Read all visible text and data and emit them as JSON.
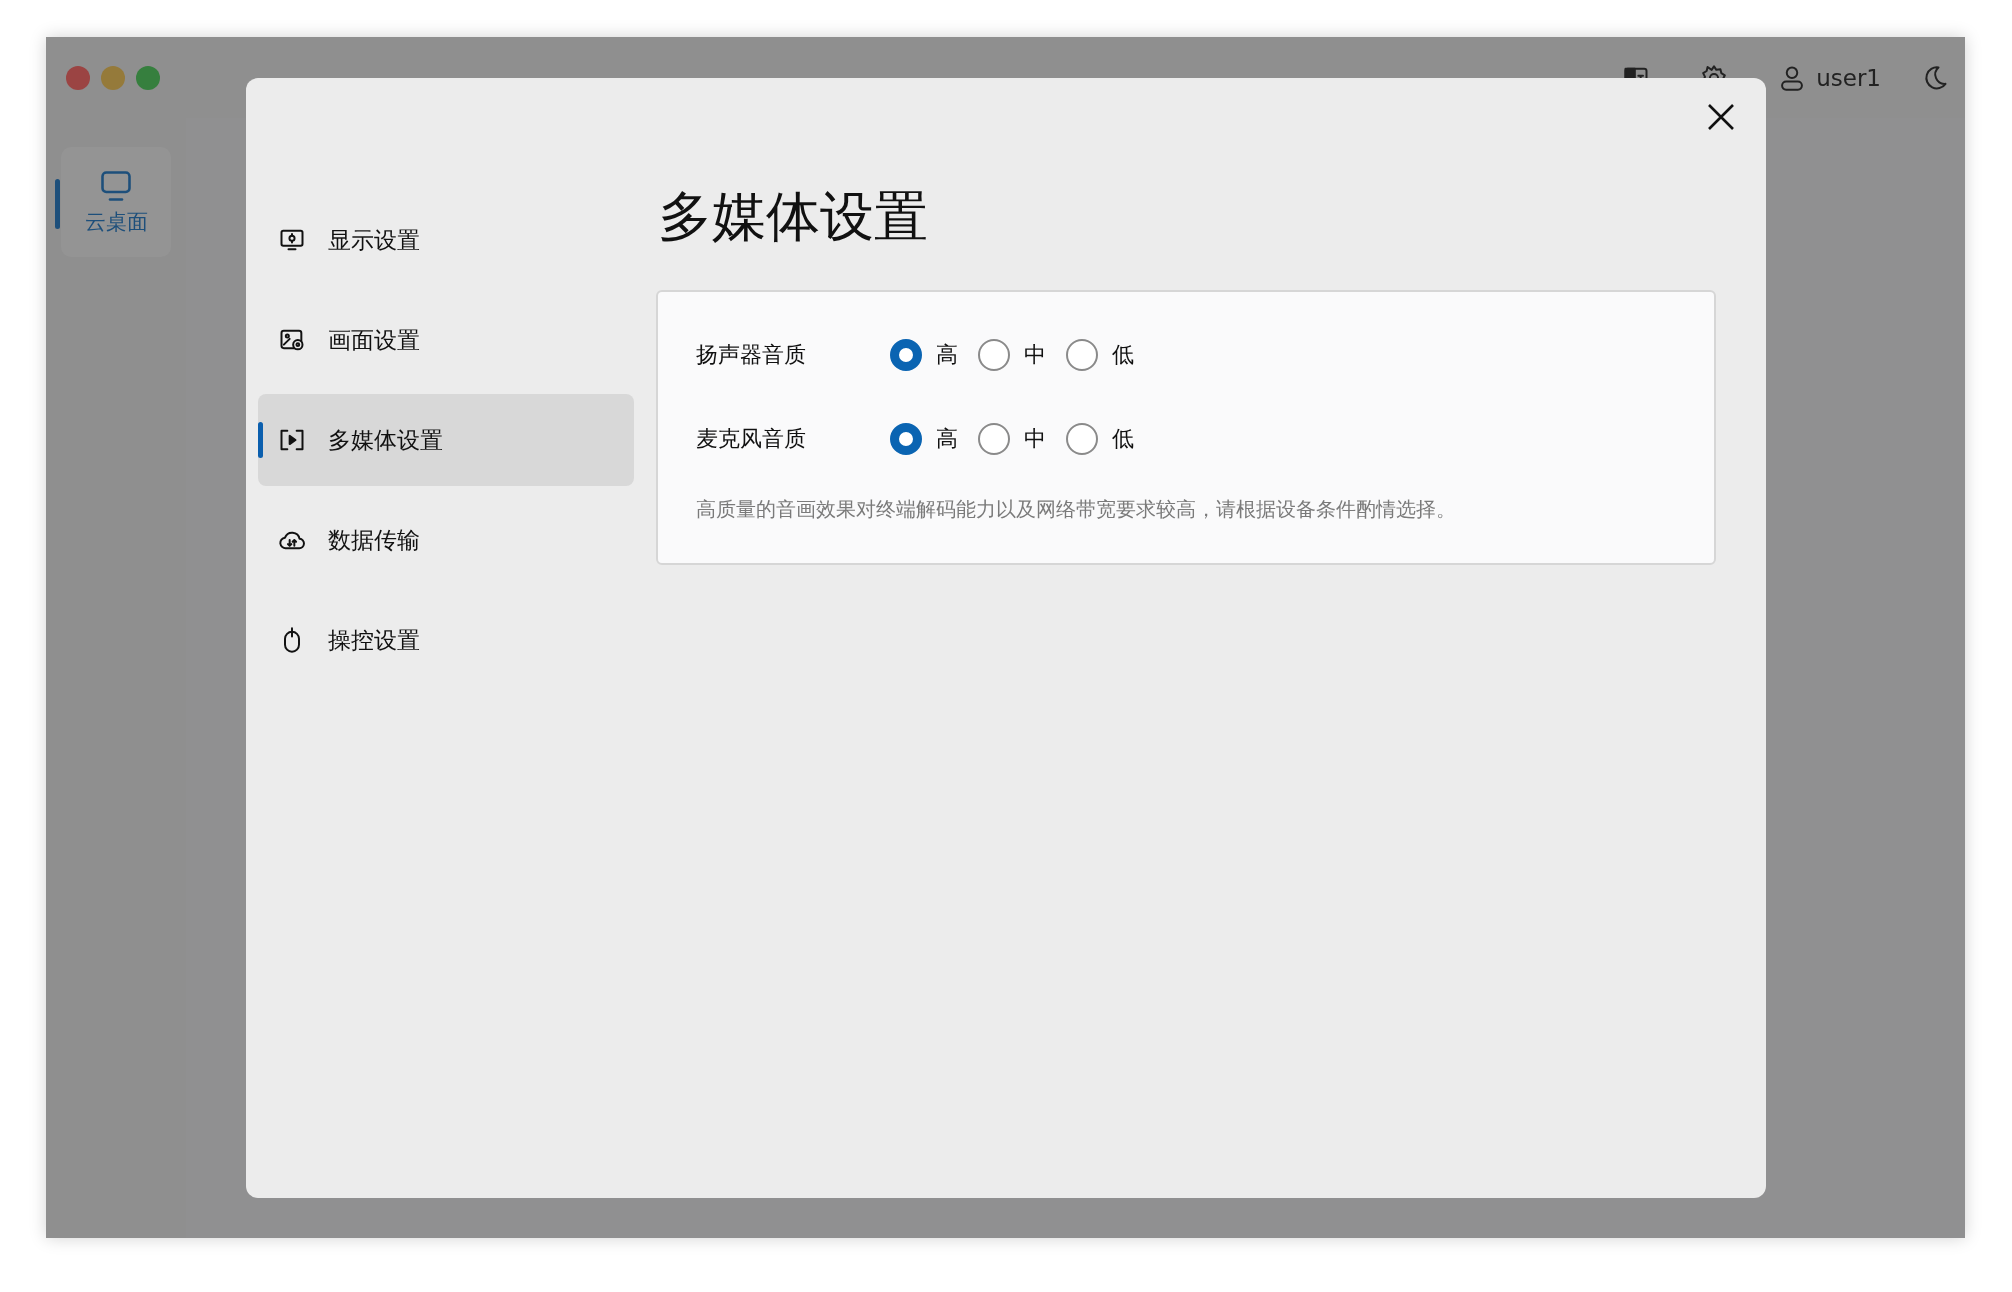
{
  "window": {
    "traffic_lights": [
      {
        "color": "#9b4443"
      },
      {
        "color": "#957a3a"
      },
      {
        "color": "#367f3e"
      }
    ]
  },
  "top_bar": {
    "user": "user1"
  },
  "rail": [
    {
      "label": "云桌面",
      "selected": true
    }
  ],
  "dialog": {
    "title": "多媒体设置",
    "nav": [
      {
        "label": "显示设置",
        "kind": "display",
        "selected": false
      },
      {
        "label": "画面设置",
        "kind": "image",
        "selected": false
      },
      {
        "label": "多媒体设置",
        "kind": "play",
        "selected": true
      },
      {
        "label": "数据传输",
        "kind": "cloud",
        "selected": false
      },
      {
        "label": "操控设置",
        "kind": "mouse",
        "selected": false
      }
    ],
    "settings": [
      {
        "label": "扬声器音质",
        "options": [
          {
            "label": "高",
            "selected": true
          },
          {
            "label": "中",
            "selected": false
          },
          {
            "label": "低",
            "selected": false
          }
        ]
      },
      {
        "label": "麦克风音质",
        "options": [
          {
            "label": "高",
            "selected": true
          },
          {
            "label": "中",
            "selected": false
          },
          {
            "label": "低",
            "selected": false
          }
        ]
      }
    ],
    "note": "高质量的音画效果对终端解码能力以及网络带宽要求较高，请根据设备条件酌情选择。"
  }
}
